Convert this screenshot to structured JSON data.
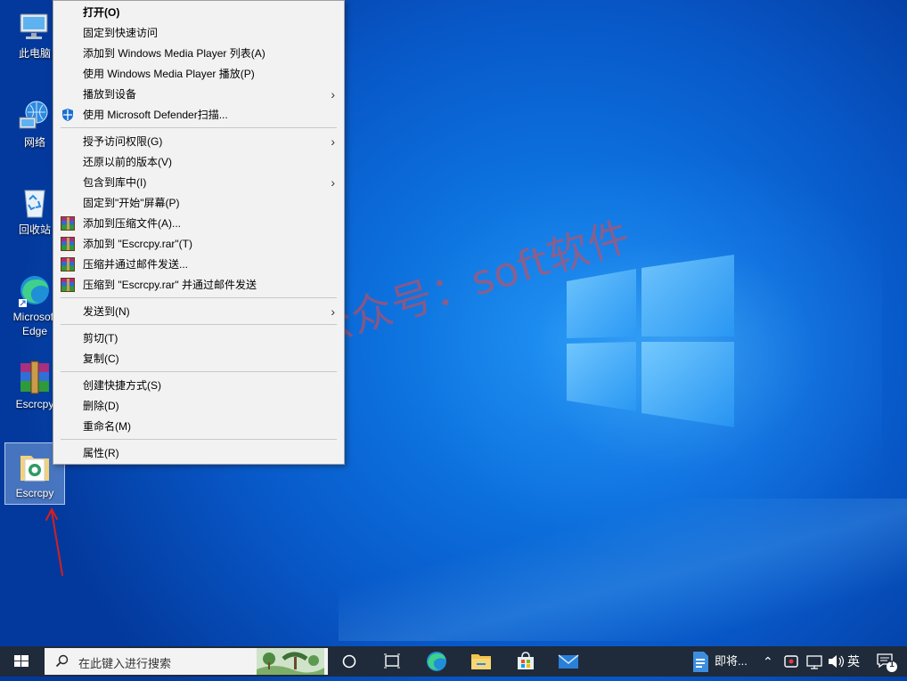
{
  "desktop": {
    "icons": [
      {
        "label": "此电脑",
        "icon": "computer-icon"
      },
      {
        "label": "网络",
        "icon": "network-icon"
      },
      {
        "label": "回收站",
        "icon": "recycle-bin-icon"
      },
      {
        "label": "Microsoft Edge",
        "icon": "edge-icon"
      },
      {
        "label": "Escrcpy",
        "icon": "winrar-archive-icon"
      },
      {
        "label": "Escrcpy",
        "icon": "folder-icon"
      }
    ]
  },
  "context_menu": {
    "items": [
      {
        "label": "打开(O)",
        "bold": true
      },
      {
        "label": "固定到快速访问"
      },
      {
        "label": "添加到 Windows Media Player 列表(A)"
      },
      {
        "label": "使用 Windows Media Player 播放(P)"
      },
      {
        "label": "播放到设备",
        "submenu": true
      },
      {
        "label": "使用 Microsoft Defender扫描...",
        "icon": "defender-shield-icon"
      },
      {
        "label": "授予访问权限(G)",
        "submenu": true
      },
      {
        "label": "还原以前的版本(V)"
      },
      {
        "label": "包含到库中(I)",
        "submenu": true
      },
      {
        "label": "固定到\"开始\"屏幕(P)"
      },
      {
        "label": "添加到压缩文件(A)...",
        "icon": "winrar-icon"
      },
      {
        "label": "添加到 \"Escrcpy.rar\"(T)",
        "icon": "winrar-icon"
      },
      {
        "label": "压缩并通过邮件发送...",
        "icon": "winrar-icon"
      },
      {
        "label": "压缩到 \"Escrcpy.rar\" 并通过邮件发送",
        "icon": "winrar-icon"
      },
      {
        "label": "发送到(N)",
        "submenu": true
      },
      {
        "label": "剪切(T)"
      },
      {
        "label": "复制(C)"
      },
      {
        "label": "创建快捷方式(S)"
      },
      {
        "label": "删除(D)"
      },
      {
        "label": "重命名(M)"
      },
      {
        "label": "属性(R)"
      }
    ],
    "submenu_arrow": "›"
  },
  "watermark": "微信公众号：soft软件",
  "taskbar": {
    "search_placeholder": "在此键入进行搜索",
    "task_label": "即将...",
    "ime": "英",
    "notification_count": "1"
  },
  "colors": {
    "annotation_red": "#d81e1e",
    "menu_bg": "#f2f2f2",
    "taskbar_bg": "#1f2a3a"
  }
}
